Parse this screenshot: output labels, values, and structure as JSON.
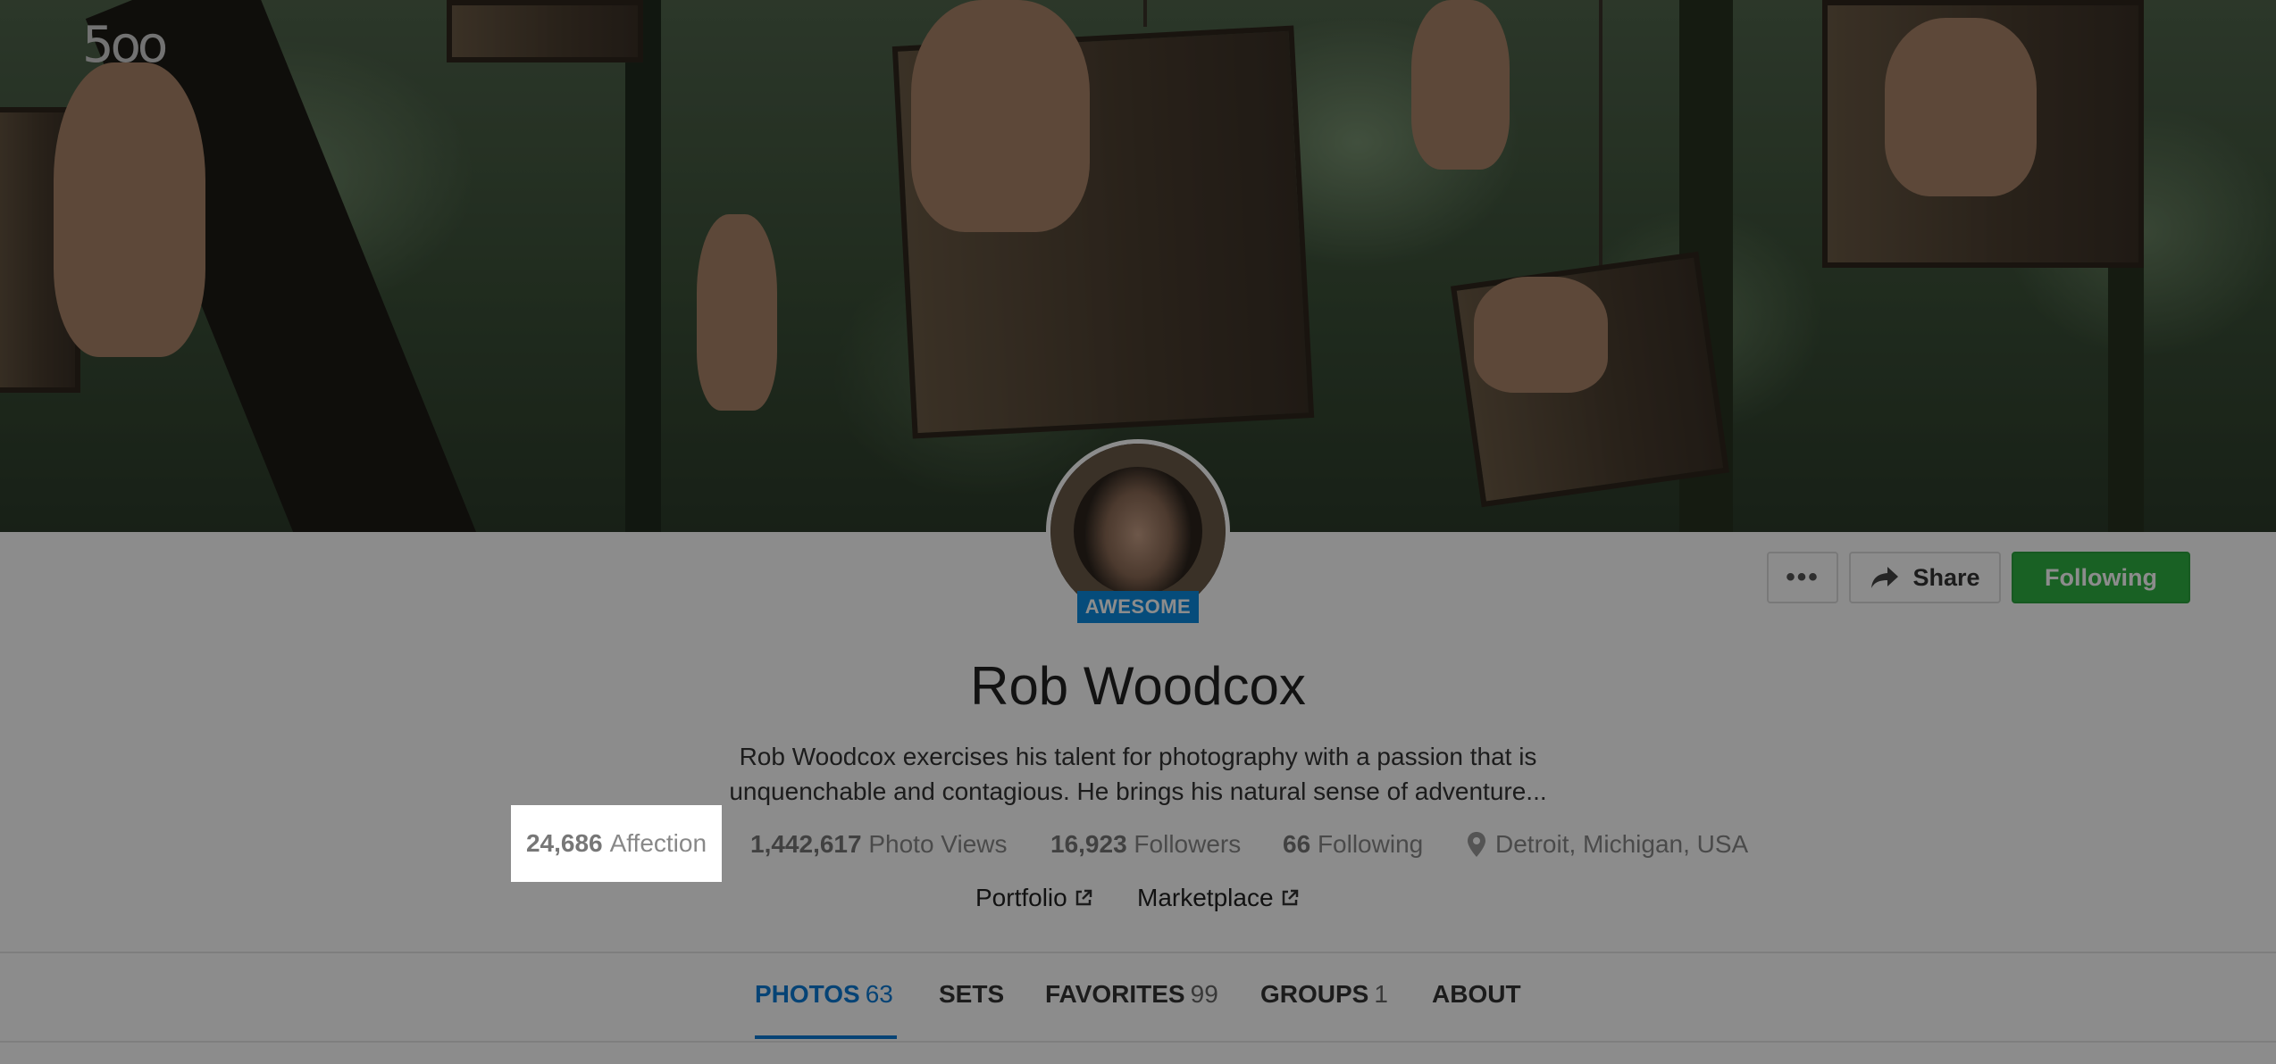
{
  "brand": {
    "logo_text": "5oo"
  },
  "profile": {
    "badge": "AWESOME",
    "name": "Rob Woodcox",
    "bio_line1": "Rob Woodcox exercises his talent for photography with a passion that is",
    "bio_line2": "unquenchable and contagious. He brings his natural sense of adventure...",
    "stats": {
      "affection_count": "24,686",
      "affection_label": "Affection",
      "views_count": "1,442,617",
      "views_label": "Photo Views",
      "followers_count": "16,923",
      "followers_label": "Followers",
      "following_count": "66",
      "following_label": "Following",
      "location": "Detroit, Michigan, USA"
    },
    "links": {
      "portfolio": "Portfolio",
      "marketplace": "Marketplace"
    }
  },
  "actions": {
    "more_label": "•••",
    "share_label": "Share",
    "follow_label": "Following"
  },
  "tabs": [
    {
      "label": "PHOTOS",
      "count": "63"
    },
    {
      "label": "SETS",
      "count": ""
    },
    {
      "label": "FAVORITES",
      "count": "99"
    },
    {
      "label": "GROUPS",
      "count": "1"
    },
    {
      "label": "ABOUT",
      "count": ""
    }
  ],
  "colors": {
    "accent": "#0b7bd6",
    "follow_green": "#2fb143",
    "badge_blue": "#0b8be0"
  }
}
